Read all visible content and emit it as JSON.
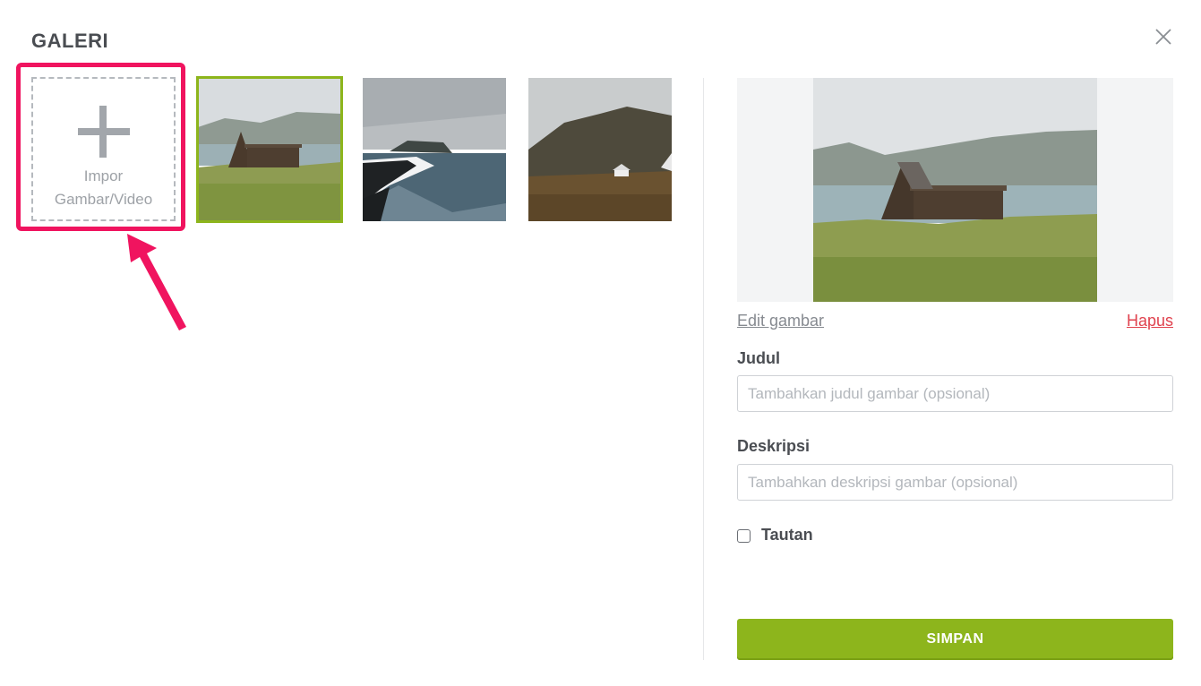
{
  "dialog": {
    "title": "GALERI"
  },
  "gallery": {
    "import_line1": "Impor",
    "import_line2": "Gambar/Video",
    "thumbnails": [
      {
        "name": "a-frame-cabin-by-lake",
        "selected": true
      },
      {
        "name": "black-sand-beach-coast",
        "selected": false
      },
      {
        "name": "misty-mountain-house",
        "selected": false
      }
    ]
  },
  "detail": {
    "edit_link": "Edit gambar",
    "delete_link": "Hapus",
    "title_label": "Judul",
    "title_placeholder": "Tambahkan judul gambar (opsional)",
    "title_value": "",
    "description_label": "Deskripsi",
    "description_placeholder": "Tambahkan deskripsi gambar (opsional)",
    "description_value": "",
    "link_label": "Tautan",
    "link_checked": false,
    "save_label": "SIMPAN"
  },
  "colors": {
    "accent_green": "#8db51c",
    "highlight_pink": "#f0145f",
    "delete_red": "#e0424e"
  },
  "icons": [
    "close-icon",
    "plus-icon",
    "arrow-annotation"
  ]
}
